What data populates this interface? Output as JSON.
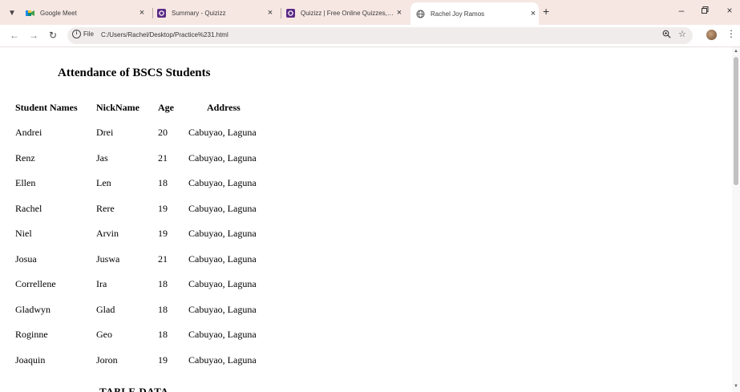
{
  "browser": {
    "tabs": [
      {
        "title": "Google Meet",
        "icon": "google-meet-icon"
      },
      {
        "title": "Summary - Quizizz",
        "icon": "quizizz-icon"
      },
      {
        "title": "Quizizz | Free Online Quizzes, Le",
        "icon": "quizizz-icon"
      },
      {
        "title": "Rachel Joy Ramos",
        "icon": "globe-icon",
        "active": true
      }
    ],
    "new_tab_label": "+",
    "site_chip": "File",
    "url": "C:/Users/Rachel/Desktop/Practice%231.html"
  },
  "page": {
    "title": "Attendance of BSCS Students",
    "headers": [
      "Student Names",
      "NickName",
      "Age",
      "Address"
    ],
    "rows": [
      {
        "name": "Andrei",
        "nick": "Drei",
        "age": "20",
        "address": "Cabuyao, Laguna"
      },
      {
        "name": "Renz",
        "nick": "Jas",
        "age": "21",
        "address": "Cabuyao, Laguna"
      },
      {
        "name": "Ellen",
        "nick": "Len",
        "age": "18",
        "address": "Cabuyao, Laguna"
      },
      {
        "name": "Rachel",
        "nick": "Rere",
        "age": "19",
        "address": "Cabuyao, Laguna"
      },
      {
        "name": "Niel",
        "nick": "Arvin",
        "age": "19",
        "address": "Cabuyao, Laguna"
      },
      {
        "name": "Josua",
        "nick": "Juswa",
        "age": "21",
        "address": "Cabuyao, Laguna"
      },
      {
        "name": "Correllene",
        "nick": "Ira",
        "age": "18",
        "address": "Cabuyao, Laguna"
      },
      {
        "name": "Gladwyn",
        "nick": "Glad",
        "age": "18",
        "address": "Cabuyao, Laguna"
      },
      {
        "name": "Roginne",
        "nick": "Geo",
        "age": "18",
        "address": "Cabuyao, Laguna"
      },
      {
        "name": "Joaquin",
        "nick": "Joron",
        "age": "19",
        "address": "Cabuyao, Laguna"
      }
    ],
    "bottom_heading": "TABLE DATA"
  },
  "colors": {
    "tabstrip": "#f6e7e3",
    "omnibox": "#f1ecec"
  }
}
